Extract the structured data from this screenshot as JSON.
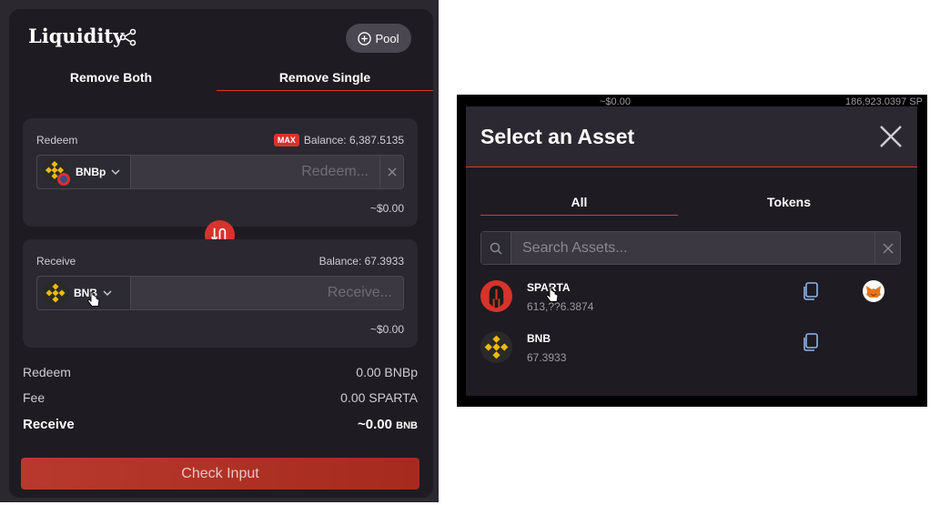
{
  "liquidity": {
    "title": "Liquidity",
    "pool_button": "Pool",
    "tabs": [
      "Remove Both",
      "Remove Single"
    ],
    "redeem": {
      "label": "Redeem",
      "max_badge": "MAX",
      "balance": "Balance: 6,387.5135",
      "asset": "BNBp",
      "placeholder": "Redeem...",
      "usd": "~$0.00"
    },
    "receive": {
      "label": "Receive",
      "balance": "Balance: 67.3933",
      "asset": "BNB",
      "placeholder": "Receive...",
      "usd": "~$0.00"
    },
    "summary": [
      {
        "label": "Redeem",
        "value": "0.00 BNBp"
      },
      {
        "label": "Fee",
        "value": "0.00 SPARTA"
      }
    ],
    "summary_receive": {
      "label": "Receive",
      "value": "~0.00",
      "unit": "BNB"
    },
    "check_button": "Check Input"
  },
  "modal": {
    "title": "Select an Asset",
    "tabs": [
      "All",
      "Tokens"
    ],
    "search_placeholder": "Search Assets...",
    "assets": [
      {
        "symbol": "SPARTA",
        "amount": "613,??6.3874"
      },
      {
        "symbol": "BNB",
        "amount": "67.3933"
      }
    ],
    "background_fragments": {
      "usd": "~$0.00",
      "amount": "186,923.0397 SP"
    }
  },
  "colors": {
    "accent_red": "#d43a2c",
    "panel_bg": "#1e1b22",
    "bnb_yellow": "#f0b90b"
  }
}
